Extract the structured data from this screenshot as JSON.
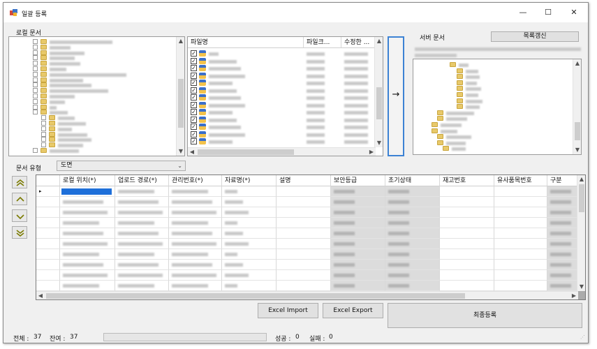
{
  "window": {
    "title": "일괄 등록",
    "minimize": "—",
    "maximize": "☐",
    "close": "✕"
  },
  "local": {
    "label": "로컬 문서"
  },
  "file_list": {
    "columns": [
      "파일명",
      "파일크...",
      "수정한 ..."
    ],
    "checked_rows": 13
  },
  "transfer": {
    "arrow": "→"
  },
  "server": {
    "label": "서버 문서",
    "refresh_button": "목록갱신"
  },
  "doc_type": {
    "label": "문서 유형",
    "value": "도면"
  },
  "grid": {
    "columns": [
      "로컬 위치(*)",
      "업로드 경로(*)",
      "관리번호(*)",
      "자료명(*)",
      "설명",
      "보안등급",
      "초기상태",
      "재고번호",
      "유사품목번호",
      "구분"
    ],
    "row_marker": "▸"
  },
  "buttons": {
    "excel_import": "Excel Import",
    "excel_export": "Excel Export",
    "final_register": "최종등록"
  },
  "status": {
    "total_label": "전체 :",
    "total_value": "37",
    "remain_label": "잔여 :",
    "remain_value": "37",
    "success_label": "성공 :",
    "success_value": "0",
    "fail_label": "실패 :",
    "fail_value": "0"
  },
  "colors": {
    "accent_border": "#3c82d4",
    "selection": "#1e6fd9",
    "panel_border": "#9a9a9a"
  },
  "icons": {
    "app": "app-icon",
    "nav": [
      "move-top-icon",
      "move-up-icon",
      "move-down-icon",
      "move-bottom-icon"
    ]
  }
}
